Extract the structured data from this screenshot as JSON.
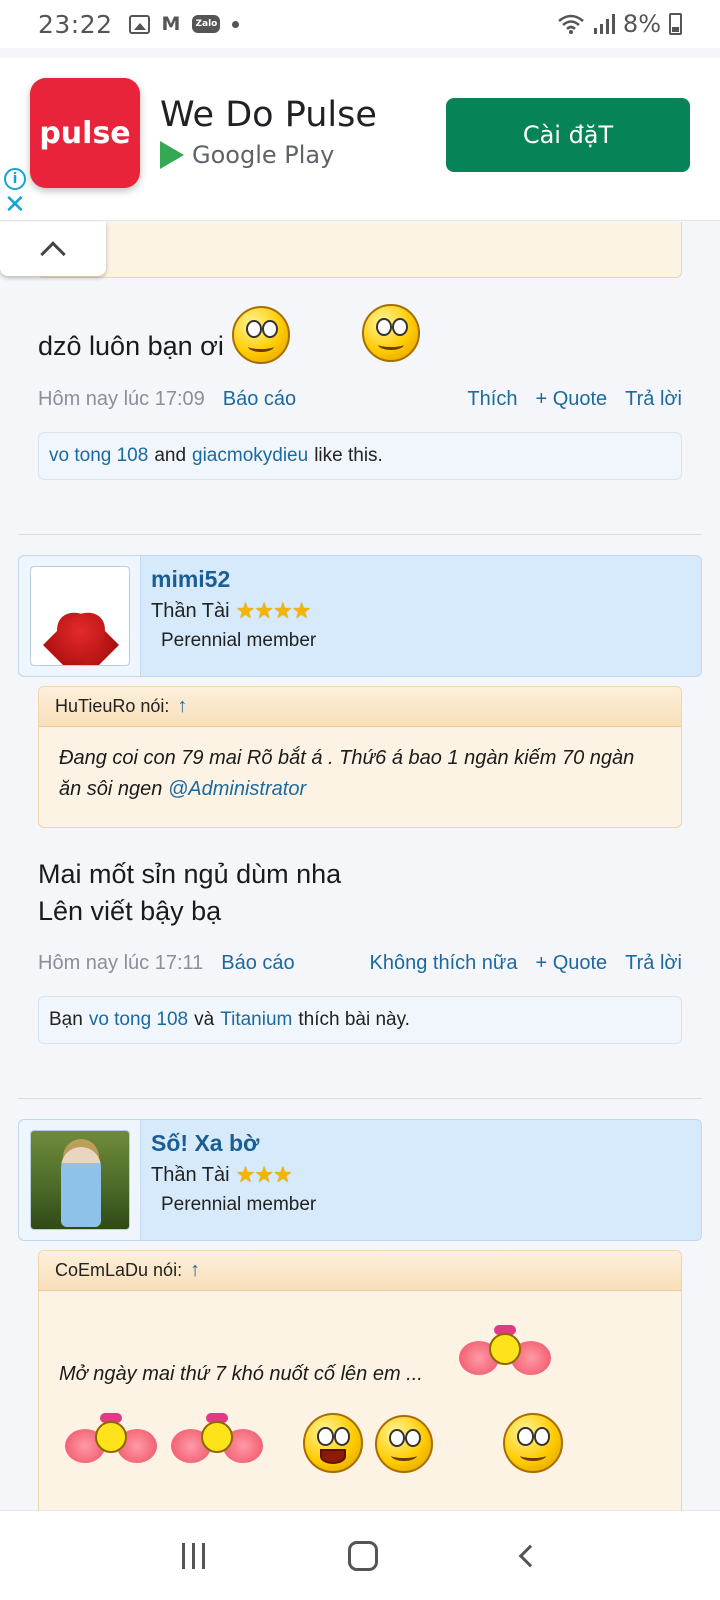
{
  "status_bar": {
    "time": "23:22",
    "battery": "8%",
    "icons": [
      "gallery-icon",
      "gmail-icon",
      "zalo-icon",
      "dot-icon",
      "wifi-icon",
      "signal-icon",
      "battery-icon"
    ]
  },
  "ad": {
    "logo_text": "pulse",
    "title": "We Do Pulse",
    "store": "Google Play",
    "cta": "Cài đặT",
    "info": "i",
    "close": "✕"
  },
  "post1": {
    "text": "dzô luôn bạn ơi",
    "date": "Hôm nay lúc 17:09",
    "report": "Báo cáo",
    "actions": [
      "Thích",
      "+ Quote",
      "Trả lời"
    ],
    "likes": {
      "users": [
        "vo tong 108",
        "giacmokydieu"
      ],
      "joiner": "and",
      "suffix": "like this."
    }
  },
  "post2": {
    "username": "mimi52",
    "user_title": "Thần Tài",
    "stars": "★★★★",
    "role": "Perennial member",
    "quote_author": "HuTieuRo nói:",
    "quote_arrow": "↑",
    "quote_text": "Đang coi con 79 mai Rõ bắt á . Thứ6 á bao 1 ngàn kiếm 70 ngàn ăn sôi ngen",
    "quote_mention": "@Administrator",
    "text_line1": "Mai mốt sỉn ngủ dùm nha",
    "text_line2": "Lên viết bậy bạ",
    "date": "Hôm nay lúc 17:11",
    "report": "Báo cáo",
    "actions": [
      "Không thích nữa",
      "+ Quote",
      "Trả lời"
    ],
    "likes": {
      "prefix": "Bạn",
      "users": [
        "vo tong 108",
        "Titanium"
      ],
      "joiner": "và",
      "suffix": "thích bài này."
    }
  },
  "post3": {
    "username": "Số! Xa bờ",
    "user_title": "Thần Tài",
    "stars": "★★★",
    "role": "Perennial member",
    "quote_author": "CoEmLaDu nói:",
    "quote_arrow": "↑",
    "quote_text": "Mở ngày mai thứ 7 khó nuốt cố lên em ..."
  },
  "nav": {
    "buttons": [
      "recent-apps-button",
      "home-button",
      "back-button"
    ]
  }
}
